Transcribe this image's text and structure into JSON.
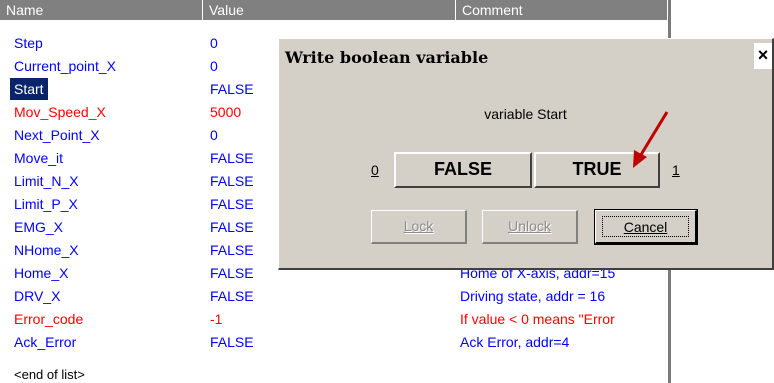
{
  "table": {
    "headers": {
      "name": "Name",
      "value": "Value",
      "comment": "Comment"
    },
    "rows": [
      {
        "name": "Step",
        "value": "0",
        "comment": "",
        "color": "blue"
      },
      {
        "name": "Current_point_X",
        "value": "0",
        "comment": "",
        "color": "blue"
      },
      {
        "name": "Start",
        "value": "FALSE",
        "comment": "",
        "color": "blue",
        "selected": true
      },
      {
        "name": "Mov_Speed_X",
        "value": "5000",
        "comment": "",
        "color": "red"
      },
      {
        "name": "Next_Point_X",
        "value": "0",
        "comment": "",
        "color": "blue"
      },
      {
        "name": "Move_it",
        "value": "FALSE",
        "comment": "",
        "color": "blue"
      },
      {
        "name": "Limit_N_X",
        "value": "FALSE",
        "comment": "",
        "color": "blue"
      },
      {
        "name": "Limit_P_X",
        "value": "FALSE",
        "comment": "",
        "color": "blue"
      },
      {
        "name": "EMG_X",
        "value": "FALSE",
        "comment": "",
        "color": "blue"
      },
      {
        "name": "NHome_X",
        "value": "FALSE",
        "comment": "",
        "color": "blue"
      },
      {
        "name": "Home_X",
        "value": "FALSE",
        "comment": "Home of X-axis, addr=15",
        "color": "blue"
      },
      {
        "name": "DRV_X",
        "value": "FALSE",
        "comment": "Driving state, addr = 16",
        "color": "blue"
      },
      {
        "name": "Error_code",
        "value": "-1",
        "comment": "If value < 0 means \"Error",
        "color": "red"
      },
      {
        "name": "Ack_Error",
        "value": "FALSE",
        "comment": "Ack Error, addr=4",
        "color": "blue"
      }
    ],
    "end_of_list": "<end of list>"
  },
  "dialog": {
    "title": "Write boolean variable",
    "close_glyph": "×",
    "message": "variable Start",
    "label_zero": "0",
    "label_one": "1",
    "false_label": "FALSE",
    "true_label": "TRUE",
    "lock_label": "Lock",
    "unlock_label": "Unlock",
    "cancel_label": "Cancel"
  },
  "colors": {
    "blue": "#0000ff",
    "red": "#ff0000",
    "arrow": "#c00000",
    "selection": "#0a246a"
  }
}
